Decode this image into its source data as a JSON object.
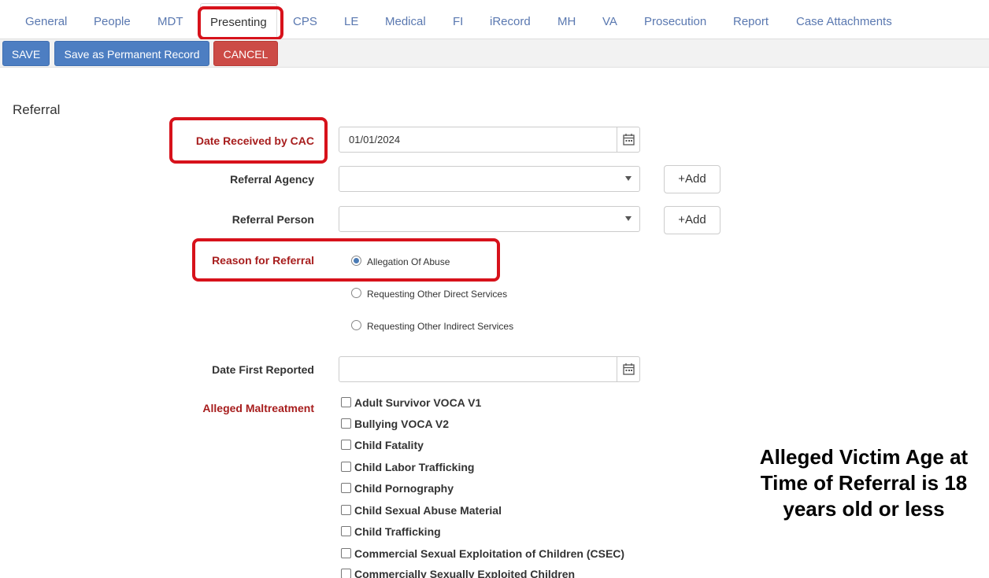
{
  "tabs": [
    "General",
    "People",
    "MDT",
    "Presenting",
    "CPS",
    "LE",
    "Medical",
    "FI",
    "iRecord",
    "MH",
    "VA",
    "Prosecution",
    "Report",
    "Case Attachments"
  ],
  "toolbar": {
    "save": "SAVE",
    "save_permanent": "Save as Permanent Record",
    "cancel": "CANCEL"
  },
  "section_title": "Referral",
  "form": {
    "date_received_label": "Date Received by CAC",
    "date_received_value": "01/01/2024",
    "referral_agency_label": "Referral Agency",
    "referral_person_label": "Referral Person",
    "add_label": "+Add",
    "reason_label": "Reason for Referral",
    "reasons": [
      "Allegation Of Abuse",
      "Requesting Other Direct Services",
      "Requesting Other Indirect Services"
    ],
    "selected_reason": "Allegation Of Abuse",
    "date_first_reported_label": "Date First Reported",
    "date_first_reported_value": "",
    "maltreatment_label": "Alleged Maltreatment",
    "maltreatment_options": [
      "Adult Survivor VOCA V1",
      "Bullying VOCA V2",
      "Child Fatality",
      "Child Labor Trafficking",
      "Child Pornography",
      "Child Sexual Abuse Material",
      "Child Trafficking",
      "Commercial Sexual Exploitation of Children (CSEC)",
      "Commercially Sexually Exploited Children"
    ]
  },
  "annotation": "Alleged Victim Age at Time of Referral is 18 years old or less",
  "colors": {
    "accent_blue": "#4d7ec2",
    "cancel_red": "#cc4b46",
    "required_label": "#a71d1d",
    "highlight_red": "#d7121b"
  }
}
